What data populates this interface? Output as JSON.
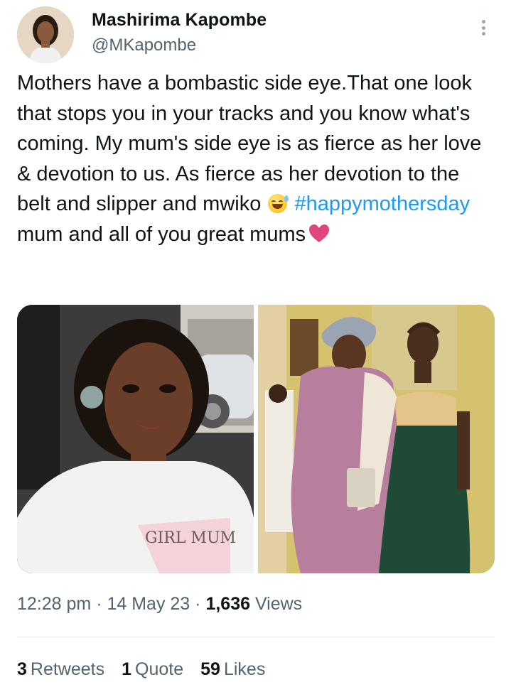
{
  "author": {
    "name": "Mashirima Kapombe",
    "handle": "@MKapombe"
  },
  "tweet": {
    "text_part1": "Mothers have a bombastic side eye.That one look that stops you in your tracks and you know what's coming. My mum's side eye is as fierce as her love & devotion to us. As fierce as her devotion to the belt and slipper and mwiko ",
    "hashtag": "#happymothersday",
    "text_part2": " mum and all of you great mums",
    "emoji_1": "grinning-sweat-emoji",
    "emoji_2": "heart-emoji"
  },
  "media": {
    "photos": [
      {
        "name": "selfie-photo"
      },
      {
        "name": "mother-daughter-photo"
      }
    ]
  },
  "meta": {
    "time": "12:28 pm",
    "sep1": " · ",
    "date": "14 May 23",
    "sep2": " · ",
    "views_count": "1,636",
    "views_label": " Views"
  },
  "stats": {
    "retweets_count": "3",
    "retweets_label": "Retweets",
    "quotes_count": "1",
    "quotes_label": "Quote",
    "likes_count": "59",
    "likes_label": "Likes"
  },
  "colors": {
    "hashtag": "#1d9bf0",
    "secondary_text": "#536471",
    "primary_text": "#0f1419",
    "heart": "#e0457b"
  }
}
